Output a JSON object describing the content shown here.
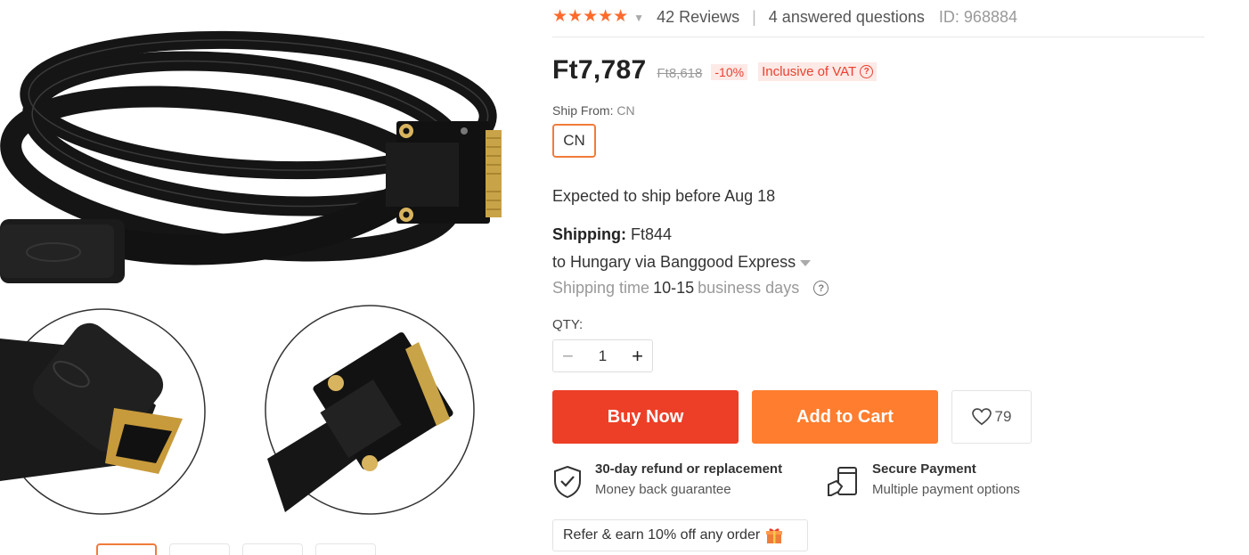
{
  "rating": {
    "stars": "★★★★★",
    "reviews": "42 Reviews",
    "answered": "4 answered questions",
    "product_id": "ID: 968884"
  },
  "price": {
    "current": "Ft7,787",
    "original": "Ft8,618",
    "discount": "-10%",
    "vat": "Inclusive of VAT"
  },
  "ship_from": {
    "label": "Ship From:",
    "value": "CN",
    "option": "CN"
  },
  "expected": "Expected to ship before Aug 18",
  "shipping": {
    "label": "Shipping:",
    "cost": "Ft844",
    "destination": "to Hungary via Banggood Express",
    "time_prefix": "Shipping time",
    "time_range": "10-15",
    "time_suffix": "business days"
  },
  "qty": {
    "label": "QTY:",
    "value": "1",
    "minus": "−",
    "plus": "+"
  },
  "buttons": {
    "buy_now": "Buy Now",
    "add_to_cart": "Add to Cart",
    "wishlist_count": "79"
  },
  "guarantees": [
    {
      "title": "30-day refund or replacement",
      "subtitle": "Money back guarantee",
      "icon": "shield-check-icon"
    },
    {
      "title": "Secure Payment",
      "subtitle": "Multiple payment options",
      "icon": "card-payment-icon"
    }
  ],
  "refer": "Refer & earn 10% off any order",
  "colors": {
    "accent": "#ff6a2c",
    "buy": "#ed3f27",
    "cart": "#ff7d2e",
    "discount": "#e8412f"
  }
}
